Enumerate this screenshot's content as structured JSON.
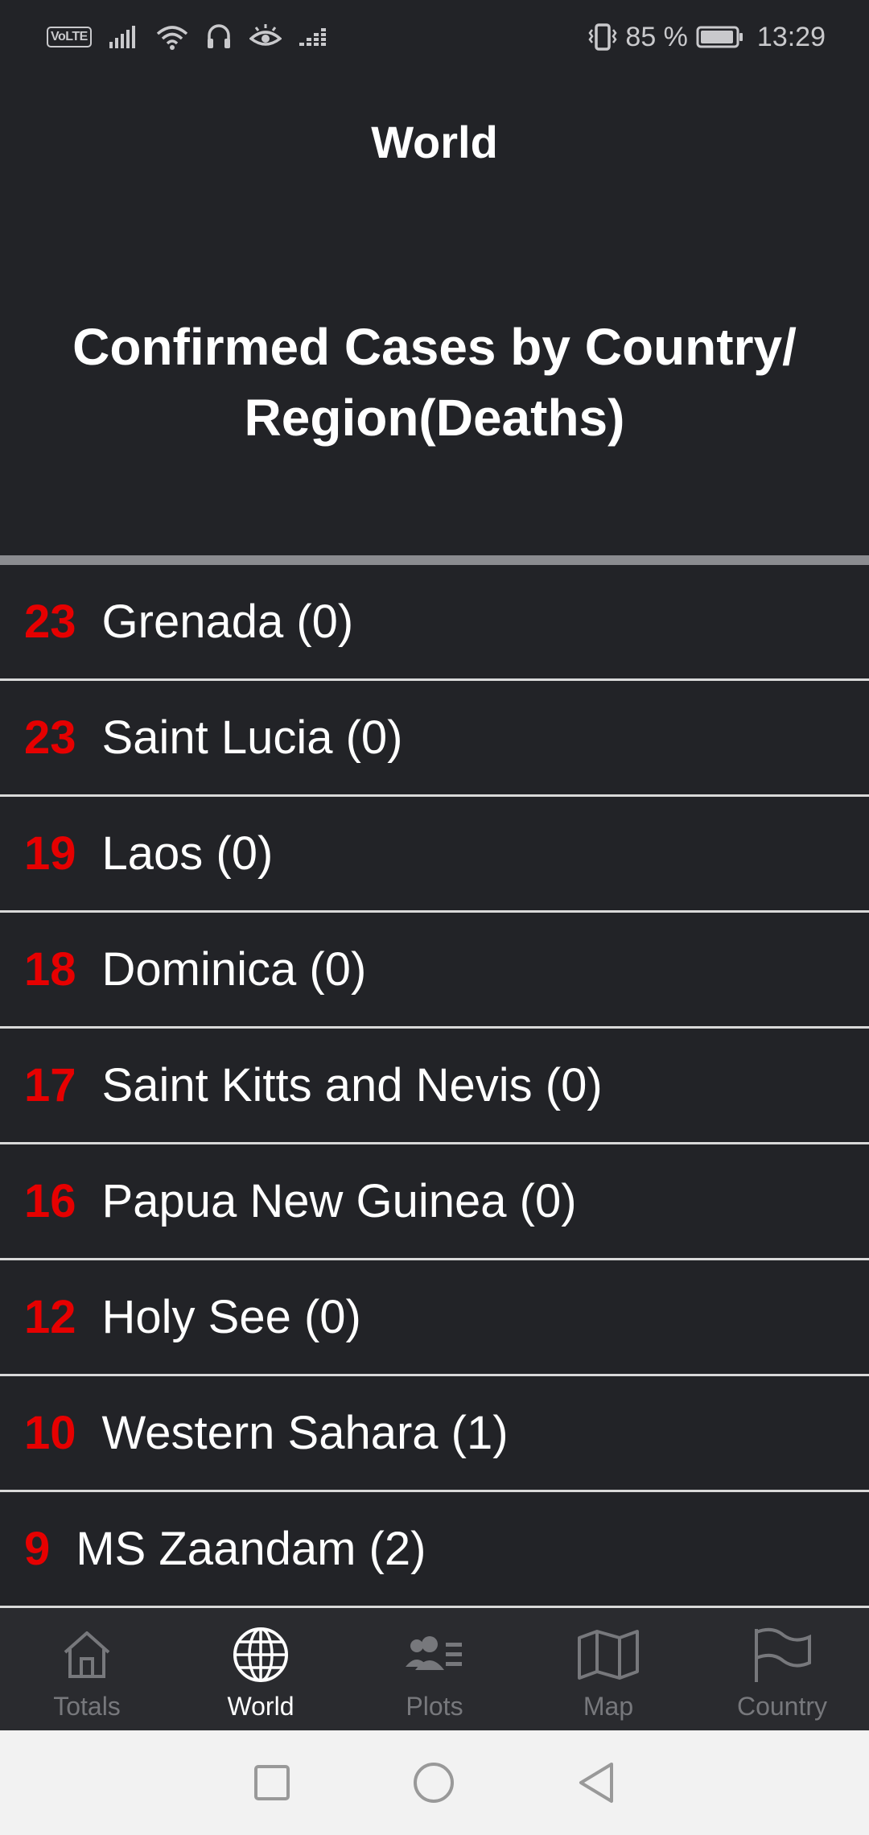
{
  "status_bar": {
    "volte": "VoLTE",
    "battery_percent": "85 %",
    "time": "13:29"
  },
  "app_bar": {
    "title": "World"
  },
  "heading": "Confirmed Cases by Country/ Region(Deaths)",
  "colors": {
    "background": "#222327",
    "count": "#e60000",
    "divider": "#d9d9d9"
  },
  "rows": [
    {
      "count": "23",
      "country": "Grenada (0)"
    },
    {
      "count": "23",
      "country": "Saint Lucia (0)"
    },
    {
      "count": "19",
      "country": "Laos (0)"
    },
    {
      "count": "18",
      "country": "Dominica (0)"
    },
    {
      "count": "17",
      "country": "Saint Kitts and Nevis (0)"
    },
    {
      "count": "16",
      "country": "Papua New Guinea (0)"
    },
    {
      "count": "12",
      "country": "Holy See (0)"
    },
    {
      "count": "10",
      "country": "Western Sahara (1)"
    },
    {
      "count": "9",
      "country": "MS Zaandam (2)"
    }
  ],
  "bottom_nav": {
    "items": [
      {
        "label": "Totals",
        "icon": "home-icon",
        "active": false
      },
      {
        "label": "World",
        "icon": "globe-icon",
        "active": true
      },
      {
        "label": "Plots",
        "icon": "people-list-icon",
        "active": false
      },
      {
        "label": "Map",
        "icon": "map-icon",
        "active": false
      },
      {
        "label": "Country",
        "icon": "flag-icon",
        "active": false
      }
    ]
  },
  "system_nav": {
    "icons": [
      "recents-square-icon",
      "home-circle-icon",
      "back-triangle-icon"
    ]
  }
}
